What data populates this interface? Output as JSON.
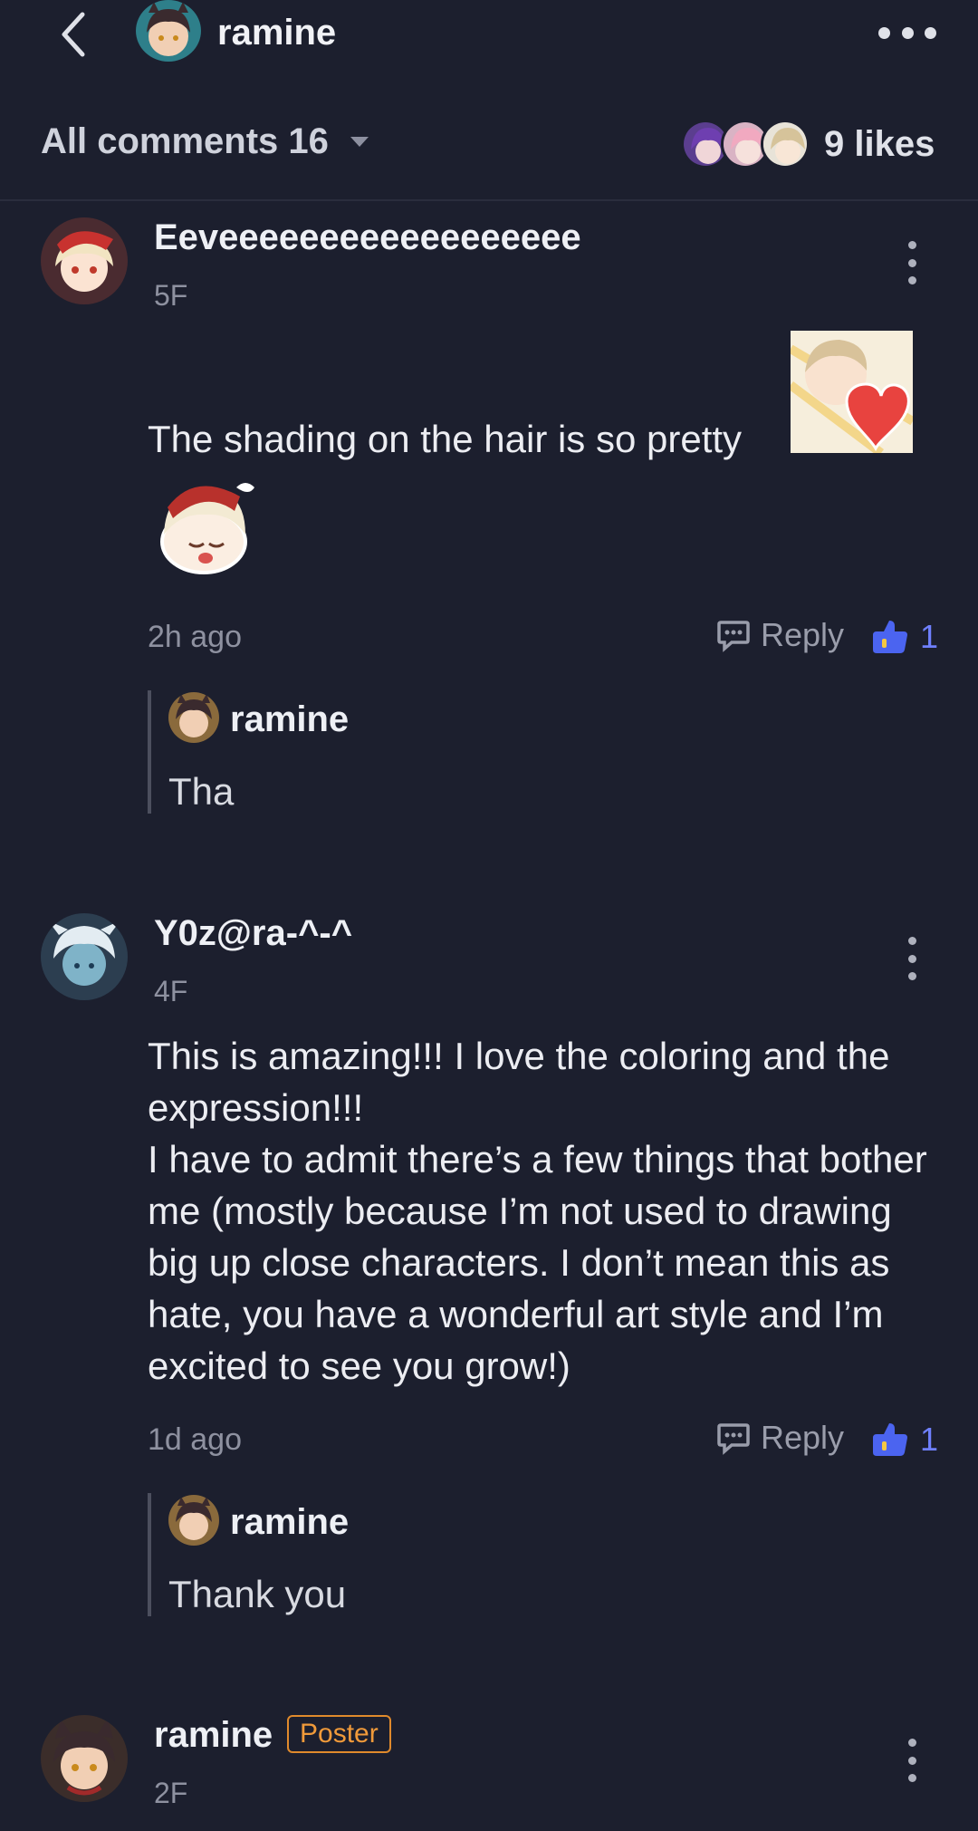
{
  "header": {
    "title": "ramine",
    "avatar_icon": "character-avatar",
    "back_icon": "chevron-left-icon",
    "more_icon": "more-horizontal-icon"
  },
  "comments_bar": {
    "label": "All comments 16",
    "likes": "9 likes"
  },
  "comments": [
    {
      "username": "Eeveeeeeeeeeeeeeeeeee",
      "floor": "5F",
      "text": "The shading on the hair is so pretty",
      "time": "2h ago",
      "reply_label": "Reply",
      "like_count": "1",
      "stickers": [
        "heart-sticker",
        "chibi-sticker"
      ],
      "reply": {
        "username": "ramine",
        "text": "Tha"
      }
    },
    {
      "username": "Y0z@ra-^-^",
      "floor": "4F",
      "text": "This is amazing!!! I love the coloring and the expression!!!",
      "text2": "I have to admit there’s a few things that bother me (mostly because I’m not used to drawing big up close characters. I don’t mean this as hate, you have a wonderful art style and I’m excited to see you grow!)",
      "time": "1d ago",
      "reply_label": "Reply",
      "like_count": "1",
      "reply": {
        "username": "ramine",
        "text": "Thank you"
      }
    },
    {
      "username": "ramine",
      "floor": "2F",
      "badge": "Poster"
    }
  ],
  "colors": {
    "background": "#1c1f2e",
    "accent_like": "#6f80ff",
    "poster_badge": "#e08a2c"
  }
}
